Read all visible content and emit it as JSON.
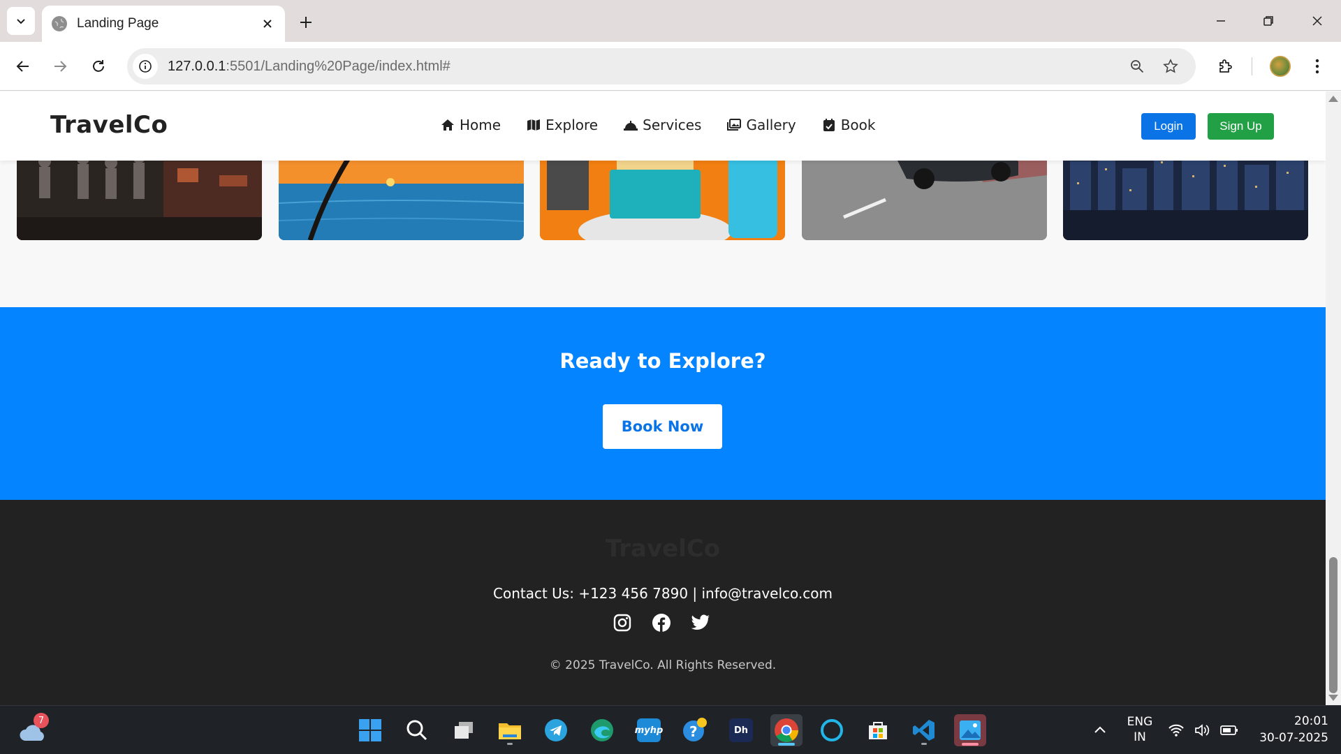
{
  "browser": {
    "tab_title": "Landing Page",
    "url_host": "127.0.0.1",
    "url_rest": ":5501/Landing%20Page/index.html#"
  },
  "site": {
    "brand": "TravelCo",
    "nav": [
      {
        "label": "Home",
        "icon": "home-icon"
      },
      {
        "label": "Explore",
        "icon": "map-icon"
      },
      {
        "label": "Services",
        "icon": "bell-icon"
      },
      {
        "label": "Gallery",
        "icon": "images-icon"
      },
      {
        "label": "Book",
        "icon": "calendar-check-icon"
      }
    ],
    "login_label": "Login",
    "signup_label": "Sign Up",
    "cta": {
      "title": "Ready to Explore?",
      "button_label": "Book Now"
    },
    "footer": {
      "brand": "TravelCo",
      "contact": "Contact Us: +123 456 7890 | info@travelco.com",
      "socials": [
        "instagram-icon",
        "facebook-icon",
        "twitter-icon"
      ],
      "copyright": "© 2025 TravelCo. All Rights Reserved."
    },
    "colors": {
      "primary_blue": "#0584ff",
      "login_blue": "#0a74e6",
      "signup_green": "#22a046",
      "footer_bg": "#222222"
    }
  },
  "taskbar": {
    "weather_badge": "7",
    "language": "ENG",
    "region": "IN",
    "time": "20:01",
    "date": "30-07-2025"
  }
}
